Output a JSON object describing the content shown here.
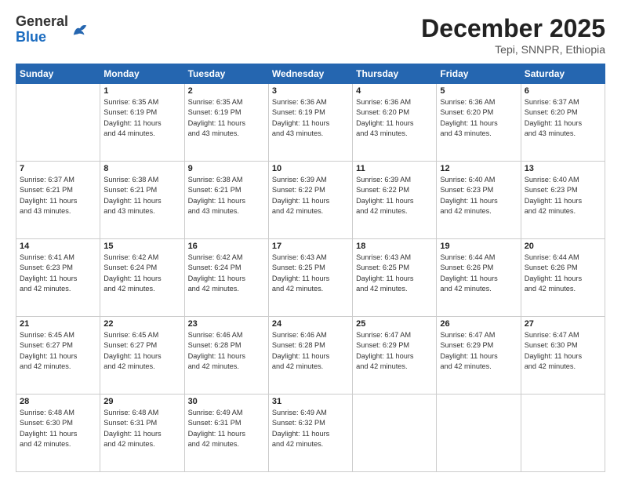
{
  "header": {
    "logo_general": "General",
    "logo_blue": "Blue",
    "month_title": "December 2025",
    "location": "Tepi, SNNPR, Ethiopia"
  },
  "days_of_week": [
    "Sunday",
    "Monday",
    "Tuesday",
    "Wednesday",
    "Thursday",
    "Friday",
    "Saturday"
  ],
  "weeks": [
    [
      {
        "day": "",
        "info": ""
      },
      {
        "day": "1",
        "info": "Sunrise: 6:35 AM\nSunset: 6:19 PM\nDaylight: 11 hours\nand 44 minutes."
      },
      {
        "day": "2",
        "info": "Sunrise: 6:35 AM\nSunset: 6:19 PM\nDaylight: 11 hours\nand 43 minutes."
      },
      {
        "day": "3",
        "info": "Sunrise: 6:36 AM\nSunset: 6:19 PM\nDaylight: 11 hours\nand 43 minutes."
      },
      {
        "day": "4",
        "info": "Sunrise: 6:36 AM\nSunset: 6:20 PM\nDaylight: 11 hours\nand 43 minutes."
      },
      {
        "day": "5",
        "info": "Sunrise: 6:36 AM\nSunset: 6:20 PM\nDaylight: 11 hours\nand 43 minutes."
      },
      {
        "day": "6",
        "info": "Sunrise: 6:37 AM\nSunset: 6:20 PM\nDaylight: 11 hours\nand 43 minutes."
      }
    ],
    [
      {
        "day": "7",
        "info": "Sunrise: 6:37 AM\nSunset: 6:21 PM\nDaylight: 11 hours\nand 43 minutes."
      },
      {
        "day": "8",
        "info": "Sunrise: 6:38 AM\nSunset: 6:21 PM\nDaylight: 11 hours\nand 43 minutes."
      },
      {
        "day": "9",
        "info": "Sunrise: 6:38 AM\nSunset: 6:21 PM\nDaylight: 11 hours\nand 43 minutes."
      },
      {
        "day": "10",
        "info": "Sunrise: 6:39 AM\nSunset: 6:22 PM\nDaylight: 11 hours\nand 42 minutes."
      },
      {
        "day": "11",
        "info": "Sunrise: 6:39 AM\nSunset: 6:22 PM\nDaylight: 11 hours\nand 42 minutes."
      },
      {
        "day": "12",
        "info": "Sunrise: 6:40 AM\nSunset: 6:23 PM\nDaylight: 11 hours\nand 42 minutes."
      },
      {
        "day": "13",
        "info": "Sunrise: 6:40 AM\nSunset: 6:23 PM\nDaylight: 11 hours\nand 42 minutes."
      }
    ],
    [
      {
        "day": "14",
        "info": "Sunrise: 6:41 AM\nSunset: 6:23 PM\nDaylight: 11 hours\nand 42 minutes."
      },
      {
        "day": "15",
        "info": "Sunrise: 6:42 AM\nSunset: 6:24 PM\nDaylight: 11 hours\nand 42 minutes."
      },
      {
        "day": "16",
        "info": "Sunrise: 6:42 AM\nSunset: 6:24 PM\nDaylight: 11 hours\nand 42 minutes."
      },
      {
        "day": "17",
        "info": "Sunrise: 6:43 AM\nSunset: 6:25 PM\nDaylight: 11 hours\nand 42 minutes."
      },
      {
        "day": "18",
        "info": "Sunrise: 6:43 AM\nSunset: 6:25 PM\nDaylight: 11 hours\nand 42 minutes."
      },
      {
        "day": "19",
        "info": "Sunrise: 6:44 AM\nSunset: 6:26 PM\nDaylight: 11 hours\nand 42 minutes."
      },
      {
        "day": "20",
        "info": "Sunrise: 6:44 AM\nSunset: 6:26 PM\nDaylight: 11 hours\nand 42 minutes."
      }
    ],
    [
      {
        "day": "21",
        "info": "Sunrise: 6:45 AM\nSunset: 6:27 PM\nDaylight: 11 hours\nand 42 minutes."
      },
      {
        "day": "22",
        "info": "Sunrise: 6:45 AM\nSunset: 6:27 PM\nDaylight: 11 hours\nand 42 minutes."
      },
      {
        "day": "23",
        "info": "Sunrise: 6:46 AM\nSunset: 6:28 PM\nDaylight: 11 hours\nand 42 minutes."
      },
      {
        "day": "24",
        "info": "Sunrise: 6:46 AM\nSunset: 6:28 PM\nDaylight: 11 hours\nand 42 minutes."
      },
      {
        "day": "25",
        "info": "Sunrise: 6:47 AM\nSunset: 6:29 PM\nDaylight: 11 hours\nand 42 minutes."
      },
      {
        "day": "26",
        "info": "Sunrise: 6:47 AM\nSunset: 6:29 PM\nDaylight: 11 hours\nand 42 minutes."
      },
      {
        "day": "27",
        "info": "Sunrise: 6:47 AM\nSunset: 6:30 PM\nDaylight: 11 hours\nand 42 minutes."
      }
    ],
    [
      {
        "day": "28",
        "info": "Sunrise: 6:48 AM\nSunset: 6:30 PM\nDaylight: 11 hours\nand 42 minutes."
      },
      {
        "day": "29",
        "info": "Sunrise: 6:48 AM\nSunset: 6:31 PM\nDaylight: 11 hours\nand 42 minutes."
      },
      {
        "day": "30",
        "info": "Sunrise: 6:49 AM\nSunset: 6:31 PM\nDaylight: 11 hours\nand 42 minutes."
      },
      {
        "day": "31",
        "info": "Sunrise: 6:49 AM\nSunset: 6:32 PM\nDaylight: 11 hours\nand 42 minutes."
      },
      {
        "day": "",
        "info": ""
      },
      {
        "day": "",
        "info": ""
      },
      {
        "day": "",
        "info": ""
      }
    ]
  ]
}
